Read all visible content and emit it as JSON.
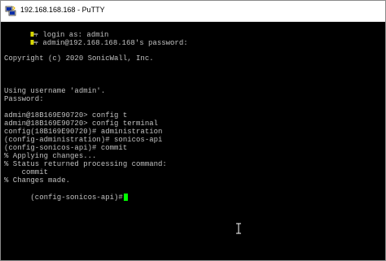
{
  "window": {
    "title": "192.168.168.168 - PuTTY"
  },
  "terminal": {
    "login_prompt": "login as: admin",
    "password_prompt": "admin@192.168.168.168's password:",
    "copyright": "Copyright (c) 2020 SonicWall, Inc.",
    "using_username": "Using username 'admin'.",
    "password_label": "Password:",
    "cmd1": "admin@18B169E90720> config t",
    "cmd2": "admin@18B169E90720> config terminal",
    "cmd3": "config(18B169E90720)# administration",
    "cmd4": "(config-administration)# sonicos-api",
    "cmd5": "(config-sonicos-api)# commit",
    "out1": "% Applying changes...",
    "out2": "% Status returned processing command:",
    "out3": "    commit",
    "out4": "% Changes made.",
    "prompt": "(config-sonicos-api)#",
    "cursor_color": "#00ff00",
    "text_color": "#c0c0c0",
    "background_color": "#000000"
  },
  "icons": {
    "app": "putty-icon",
    "mouse": "text-cursor-icon"
  }
}
